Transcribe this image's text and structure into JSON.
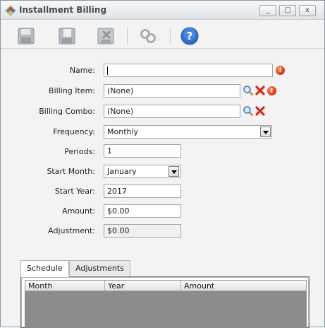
{
  "window": {
    "title": "Installment Billing",
    "minimize_label": "_",
    "maximize_label": "□",
    "close_label": "x"
  },
  "toolbar": {
    "buttons": [
      "save-icon",
      "save-and-new-icon",
      "delete-icon",
      "link-icon",
      "help-icon"
    ]
  },
  "form": {
    "name": {
      "label": "Name:",
      "value": ""
    },
    "billing_item": {
      "label": "Billing Item:",
      "value": "(None)"
    },
    "billing_combo": {
      "label": "Billing Combo:",
      "value": "(None)"
    },
    "frequency": {
      "label": "Frequency:",
      "value": "Monthly"
    },
    "periods": {
      "label": "Periods:",
      "value": "1"
    },
    "start_month": {
      "label": "Start Month:",
      "value": "January"
    },
    "start_year": {
      "label": "Start Year:",
      "value": "2017"
    },
    "amount": {
      "label": "Amount:",
      "value": "$0.00"
    },
    "adjustment": {
      "label": "Adjustment:",
      "value": "$0.00"
    },
    "required_marker": "!"
  },
  "tabs": [
    {
      "label": "Schedule",
      "active": true
    },
    {
      "label": "Adjustments",
      "active": false
    }
  ],
  "grid": {
    "columns": [
      "Month",
      "Year",
      "Amount"
    ]
  },
  "colors": {
    "title_text": "#4a4a4a",
    "error_red": "#d4300c",
    "help_blue": "#2f6fc9",
    "grid_body": "#8c8c8c"
  }
}
